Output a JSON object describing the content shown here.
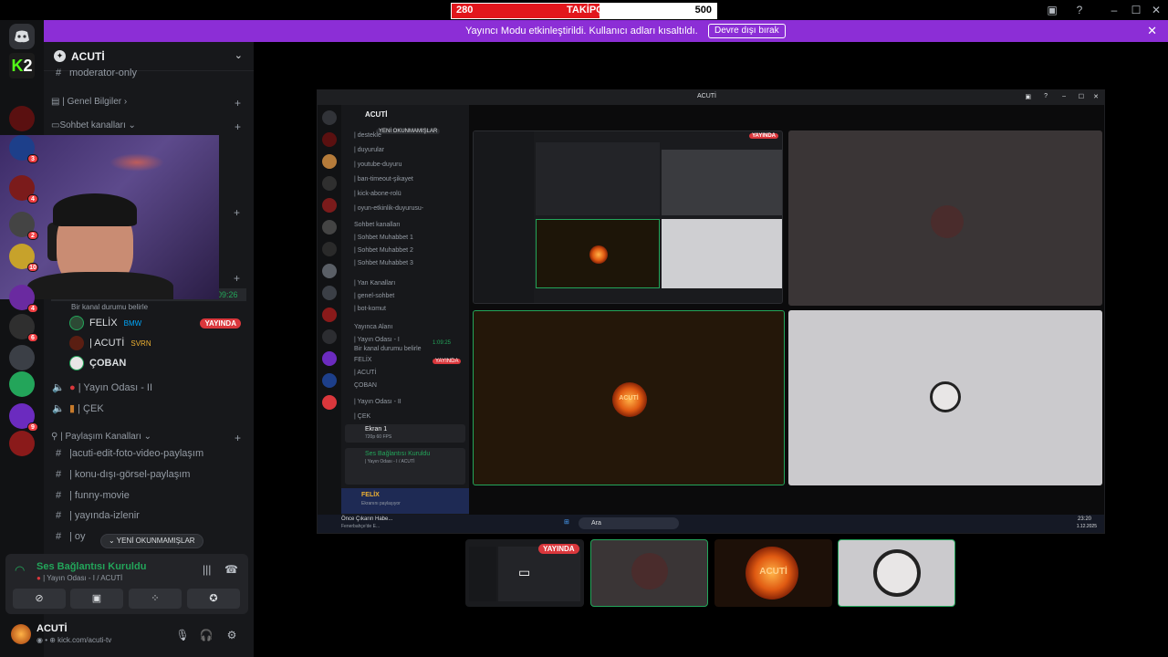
{
  "goal": {
    "current": "280",
    "label": "TAKİPÇİ",
    "max": "500",
    "progress": 0.56
  },
  "window_controls": {
    "minimize": "–",
    "maximize": "☐",
    "close": "✕"
  },
  "banner": {
    "text": "Yayıncı Modu etkinleştirildi. Kullanıcı adları kısaltıldı.",
    "button": "Devre dışı bırak",
    "close": "✕"
  },
  "servers": [
    {
      "label": "K2",
      "color": "#1b1b1b",
      "badge": ""
    },
    {
      "label": "",
      "color": "#5a1010",
      "badge": ""
    },
    {
      "label": "",
      "color": "#1d3f8a",
      "badge": "3"
    },
    {
      "label": "",
      "color": "#7b1b1b",
      "badge": "4"
    },
    {
      "label": "",
      "color": "#444",
      "badge": "2"
    },
    {
      "label": "",
      "color": "#c7a22b",
      "badge": "10"
    },
    {
      "label": "",
      "color": "#6a2aa0",
      "badge": "4"
    },
    {
      "label": "",
      "color": "#2f2f2f",
      "badge": "6"
    },
    {
      "label": "",
      "color": "#3b3f46",
      "badge": ""
    },
    {
      "label": "",
      "color": "#23a55a",
      "badge": ""
    },
    {
      "label": "",
      "color": "#6b2bbf",
      "badge": "9"
    },
    {
      "label": "",
      "color": "#8a1a1a",
      "badge": ""
    }
  ],
  "sidebar": {
    "server_name": "ACUTİ",
    "channels_top": [
      {
        "icon": "#",
        "label": "moderator-only"
      }
    ],
    "categories": {
      "genel": "Genel Bilgiler",
      "sohbet": "Sohbet kanalları",
      "paylasim": "Paylaşım Kanalları"
    },
    "channel_status": "Bir kanal durumu belirle",
    "timer": "09:26",
    "voice_users": [
      {
        "name": "FELİX",
        "tag": "BMW",
        "live": "YAYINDA"
      },
      {
        "name": "| ACUTİ",
        "tag": "SVRN",
        "live": ""
      },
      {
        "name": "ÇOBAN",
        "tag": "",
        "live": ""
      }
    ],
    "voice_channels": [
      {
        "label": "| Yayın Odası - II"
      },
      {
        "label": "| ÇEK"
      }
    ],
    "text_channels": [
      {
        "label": "|acuti-edit-foto-video-paylaşım"
      },
      {
        "label": "| konu-dışı-görsel-paylaşım"
      },
      {
        "label": "| funny-movie"
      },
      {
        "label": "| yayında-izlenir"
      },
      {
        "label": "| oy"
      }
    ],
    "new_unreads": "YENİ OKUNMAMIŞLAR"
  },
  "voice_panel": {
    "status": "Ses Bağlantısı Kuruldu",
    "channel": "| Yayın Odası - I / ACUTİ"
  },
  "user_panel": {
    "name": "ACUTİ",
    "status": "kick.com/acuti-tv"
  },
  "embedded": {
    "title": "ACUTİ",
    "server": "ACUTİ",
    "unread": "YENİ OKUNMAMIŞLAR",
    "channels": [
      "| destekle",
      "| duyurular",
      "| youtube-duyuru",
      "| ban-timeout-şikayet",
      "| kick-abone-rolü",
      "| oyun-etkinlik-duyurusu-",
      "Sohbet kanalları",
      "| Sohbet Muhabbet 1",
      "| Sohbet Muhabbet 2",
      "| Sohbet Muhabbet 3",
      "| Yan Kanalları",
      "| genel-sohbet",
      "| bot-komut",
      "Yayınca Alanı",
      "| Yayın Odası - I",
      "Bir kanal durumu belirle",
      "FELİX",
      "| ACUTİ",
      "ÇOBAN",
      "| Yayın Odası - II",
      "| ÇEK"
    ],
    "embed_timer": "1:09:25",
    "embed_live": "YAYINDA",
    "screen": {
      "name": "Ekran 1",
      "sub": "720p 60 FPS"
    },
    "voice": {
      "status": "Ses Bağlantısı Kuruldu",
      "channel": "| Yayın Odası - I / ACUTİ"
    },
    "user": {
      "name": "FELİX",
      "sub": "Ekranını paylaşıyor"
    },
    "taskbar": {
      "search": "Ara",
      "news": "Önce Çıkarın Habe...",
      "news_sub": "Fenerbahçe'de E...",
      "time": "23:20",
      "date": "1.12.2025"
    },
    "tile_live": "YAYINDA",
    "sun_label": "ACUTİ"
  },
  "thumbs": {
    "live": "YAYINDA",
    "sun_label": "ACUTİ"
  }
}
